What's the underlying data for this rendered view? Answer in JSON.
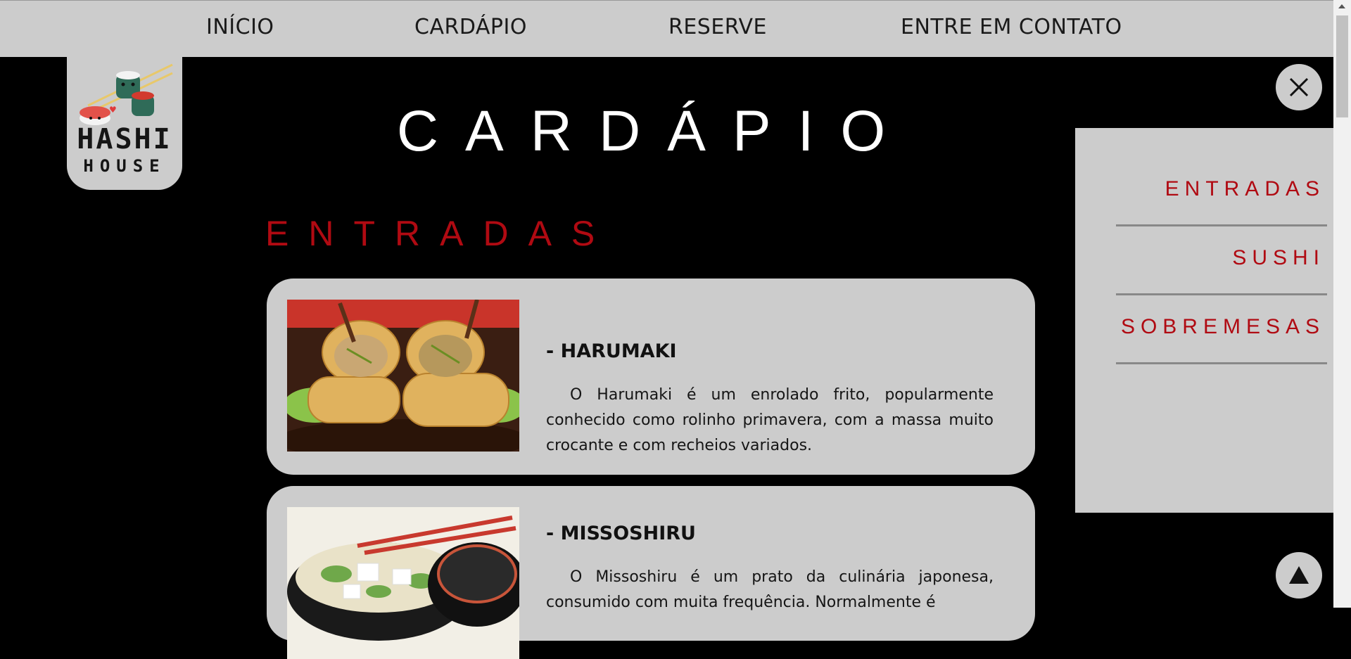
{
  "nav": {
    "items": [
      "INÍCIO",
      "CARDÁPIO",
      "RESERVE",
      "ENTRE EM CONTATO"
    ]
  },
  "logo": {
    "line1": "HASHI",
    "line2": "HOUSE"
  },
  "page": {
    "title": "CARDÁPIO",
    "section_title": "ENTRADAS"
  },
  "menu_items": [
    {
      "name": "- HARUMAKI",
      "description": "O Harumaki é um enrolado frito, popularmente conhecido como rolinho primavera, com a massa muito crocante e com recheios variados."
    },
    {
      "name": "- MISSOSHIRU",
      "description": "O Missoshiru é um prato da culinária japonesa, consumido com muita frequência. Normalmente é"
    }
  ],
  "side_menu": {
    "items": [
      "ENTRADAS",
      "SUSHI",
      "SOBREMESAS"
    ]
  },
  "icons": {
    "close": "close-icon",
    "up": "arrow-up-icon"
  },
  "colors": {
    "accent_red": "#b00a12",
    "panel_gray": "#cccccc",
    "background": "#000000"
  }
}
